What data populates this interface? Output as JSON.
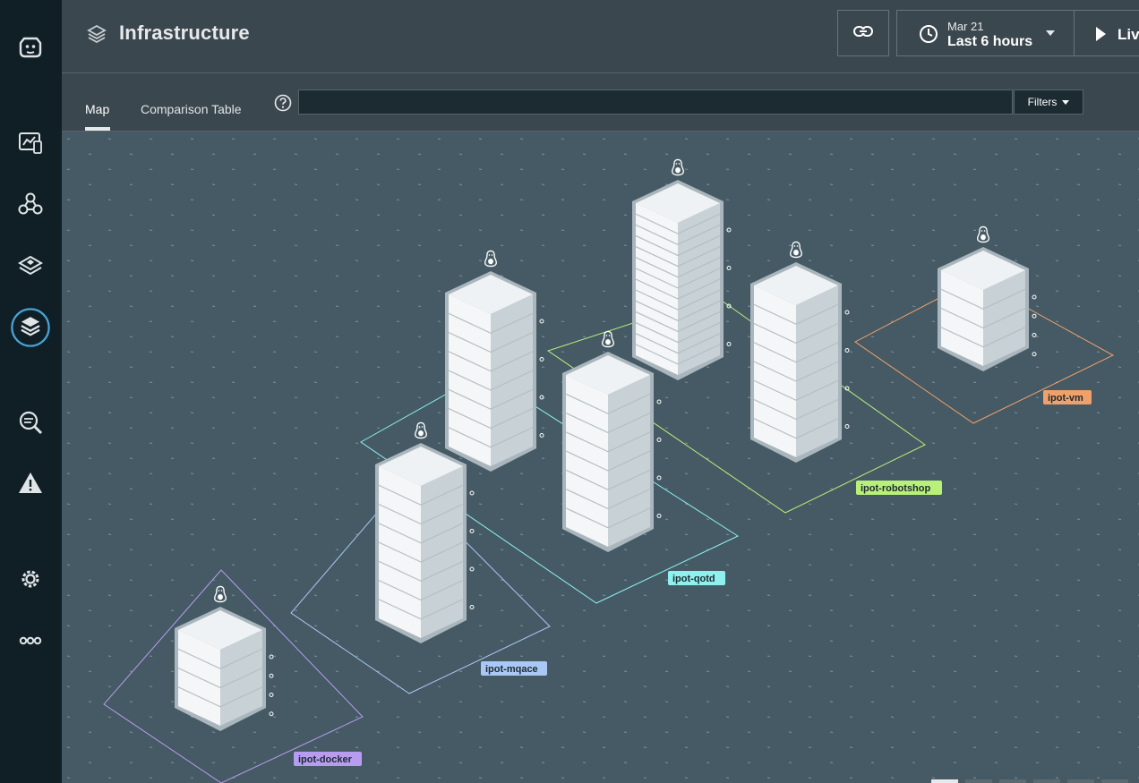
{
  "header": {
    "title": "Infrastructure",
    "time": {
      "date": "Mar 21",
      "range": "Last 6 hours"
    },
    "live_label": "Live"
  },
  "tabs": [
    {
      "label": "Map",
      "active": true
    },
    {
      "label": "Comparison Table",
      "active": false
    }
  ],
  "search": {
    "value": "",
    "placeholder": ""
  },
  "filters_label": "Filters",
  "sidebar": {
    "items": [
      {
        "icon": "app-logo-icon"
      },
      {
        "icon": "monitoring-icon"
      },
      {
        "icon": "services-icon"
      },
      {
        "icon": "platforms-icon"
      },
      {
        "icon": "infrastructure-icon",
        "active": true
      },
      {
        "icon": "analytics-icon"
      },
      {
        "icon": "alerts-icon"
      },
      {
        "icon": "settings-icon"
      },
      {
        "icon": "more-icon"
      }
    ]
  },
  "zones": [
    {
      "name": "ipot-docker",
      "color": "#b79cf0"
    },
    {
      "name": "ipot-mqace",
      "color": "#a9c8f5"
    },
    {
      "name": "ipot-qotd",
      "color": "#8ef0ef"
    },
    {
      "name": "ipot-robotshop",
      "color": "#b8f07a"
    },
    {
      "name": "ipot-vm",
      "color": "#f0a06b"
    }
  ],
  "colors": {
    "sidebar": "#101f26",
    "header": "#3b474e",
    "map": "#455a64",
    "accent": "#4aa3d6"
  }
}
